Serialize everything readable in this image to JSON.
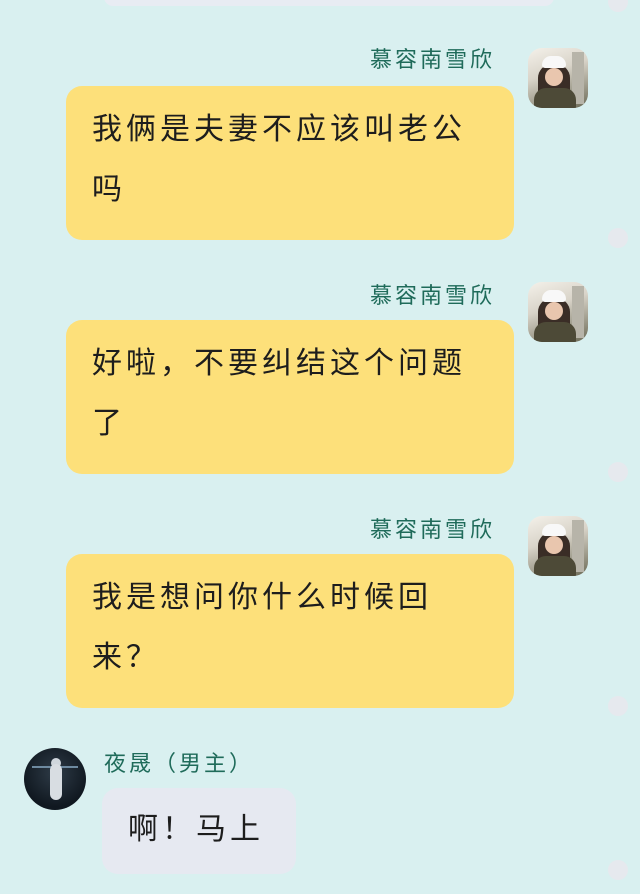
{
  "messages": [
    {
      "sender": "慕容南雪欣",
      "lines": [
        "我俩是夫妻不应该叫老公",
        "吗"
      ]
    },
    {
      "sender": "慕容南雪欣",
      "lines": [
        "好啦，不要纠结这个问题",
        "了"
      ]
    },
    {
      "sender": "慕容南雪欣",
      "lines": [
        "我是想问你什么时候回",
        "来？"
      ]
    },
    {
      "sender": "夜晟（男主）",
      "lines": [
        "啊！马上"
      ]
    }
  ],
  "colors": {
    "background": "#d9f0f0",
    "my_bubble": "#fde07a",
    "their_bubble": "#e6e9f1",
    "name": "#1f6b5a"
  },
  "icons": {
    "select_dot": "select-dot-icon"
  }
}
